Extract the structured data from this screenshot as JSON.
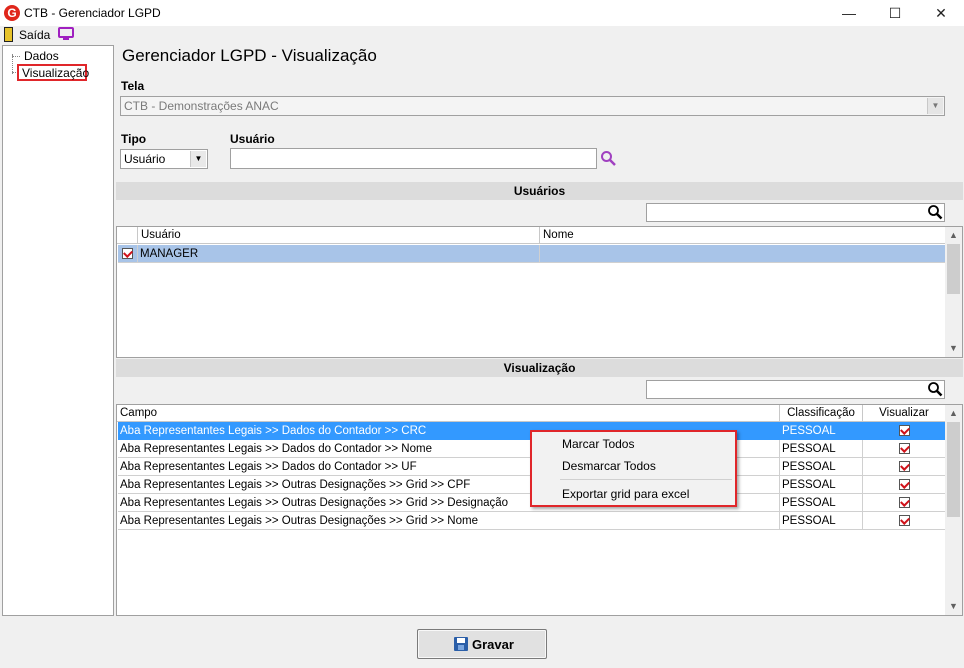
{
  "window": {
    "title": "CTB - Gerenciador LGPD",
    "app_icon": "G",
    "minimize": "—",
    "maximize": "☐",
    "close": "✕"
  },
  "toolbar": {
    "exit_label": "Saída"
  },
  "nav": {
    "items": [
      {
        "label": "Dados"
      },
      {
        "label": "Visualização"
      }
    ]
  },
  "page": {
    "title": "Gerenciador LGPD - Visualização"
  },
  "form": {
    "tela_label": "Tela",
    "tela_value": "CTB - Demonstrações ANAC",
    "tipo_label": "Tipo",
    "tipo_value": "Usuário",
    "usuario_label": "Usuário",
    "usuario_value": ""
  },
  "users_section": {
    "title": "Usuários",
    "search_value": "",
    "columns": [
      "Usuário",
      "Nome"
    ],
    "rows": [
      {
        "usuario": "MANAGER",
        "nome": "",
        "checked": true
      }
    ]
  },
  "view_section": {
    "title": "Visualização",
    "search_value": "",
    "columns": [
      "Campo",
      "Classificação",
      "Visualizar"
    ],
    "rows": [
      {
        "campo": "Aba Representantes Legais  >> Dados do Contador  >>  CRC",
        "classificacao": "PESSOAL",
        "visualizar": true
      },
      {
        "campo": "Aba Representantes Legais  >> Dados do Contador  >>  Nome",
        "classificacao": "PESSOAL",
        "visualizar": true
      },
      {
        "campo": "Aba Representantes Legais  >> Dados do Contador  >> UF",
        "classificacao": "PESSOAL",
        "visualizar": true
      },
      {
        "campo": "Aba Representantes Legais  >> Outras Designações >> Grid >> CPF",
        "classificacao": "PESSOAL",
        "visualizar": true
      },
      {
        "campo": "Aba Representantes Legais  >> Outras Designações >> Grid >> Designação",
        "classificacao": "PESSOAL",
        "visualizar": true
      },
      {
        "campo": "Aba Representantes Legais  >> Outras Designações >> Grid >> Nome",
        "classificacao": "PESSOAL",
        "visualizar": true
      }
    ]
  },
  "context_menu": {
    "items": [
      "Marcar Todos",
      "Desmarcar Todos",
      "Exportar grid para excel"
    ]
  },
  "footer": {
    "save_label": "Gravar"
  },
  "colors": {
    "selection": "#3399ff",
    "highlight_border": "#e0262a",
    "check": "#d0121a"
  }
}
